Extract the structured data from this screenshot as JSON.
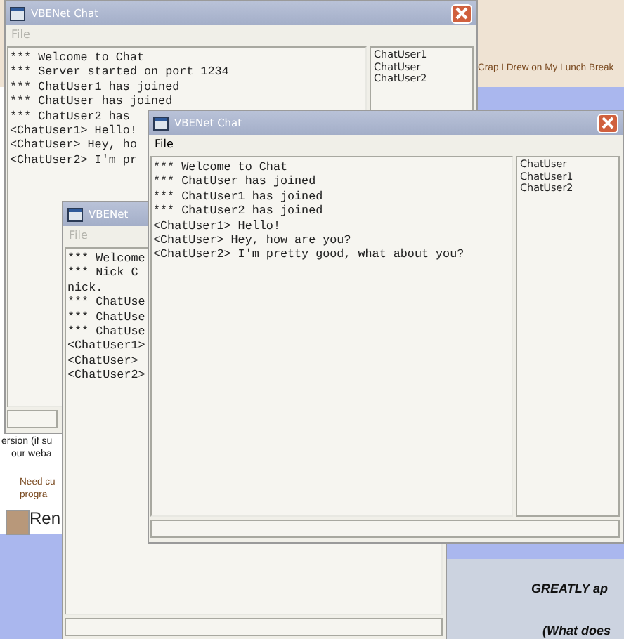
{
  "background_page": {
    "texts": [
      {
        "kind": "link",
        "text": "Crap I Drew on My Lunch Break"
      },
      {
        "kind": "plain",
        "text": "ersion (if su"
      },
      {
        "kind": "plain",
        "text": "our weba"
      },
      {
        "kind": "link",
        "text": "Need cu"
      },
      {
        "kind": "link",
        "text": "progra"
      },
      {
        "kind": "logo",
        "text": "Ren"
      },
      {
        "kind": "bold",
        "text": "GREATLY ap"
      },
      {
        "kind": "bold",
        "text": "(What does"
      }
    ]
  },
  "windows": [
    {
      "title": "VBENet Chat",
      "menu": [
        {
          "label": "File",
          "disabled": true
        }
      ],
      "messages": [
        "*** Welcome to Chat",
        "*** Server started on port 1234",
        "*** ChatUser1 has joined",
        "*** ChatUser has joined",
        "*** ChatUser2 has",
        "<ChatUser1> Hello!",
        "<ChatUser> Hey, ho",
        "<ChatUser2> I'm pr"
      ],
      "users": [
        "ChatUser1",
        "ChatUser",
        "ChatUser2"
      ]
    },
    {
      "title": "VBENet",
      "menu": [
        {
          "label": "File",
          "disabled": true
        }
      ],
      "messages": [
        "*** Welcome",
        "*** Nick C",
        "nick.",
        "*** ChatUse",
        "*** ChatUse",
        "*** ChatUse",
        "<ChatUser1>",
        "<ChatUser>",
        "<ChatUser2>"
      ]
    },
    {
      "title": "VBENet Chat",
      "menu": [
        {
          "label": "File",
          "disabled": false
        }
      ],
      "messages": [
        "*** Welcome to Chat",
        "*** ChatUser has joined",
        "*** ChatUser1 has joined",
        "*** ChatUser2 has joined",
        "<ChatUser1> Hello!",
        "<ChatUser> Hey, how are you?",
        "<ChatUser2> I'm pretty good, what about you?"
      ],
      "users": [
        "ChatUser",
        "ChatUser1",
        "ChatUser2"
      ]
    }
  ]
}
